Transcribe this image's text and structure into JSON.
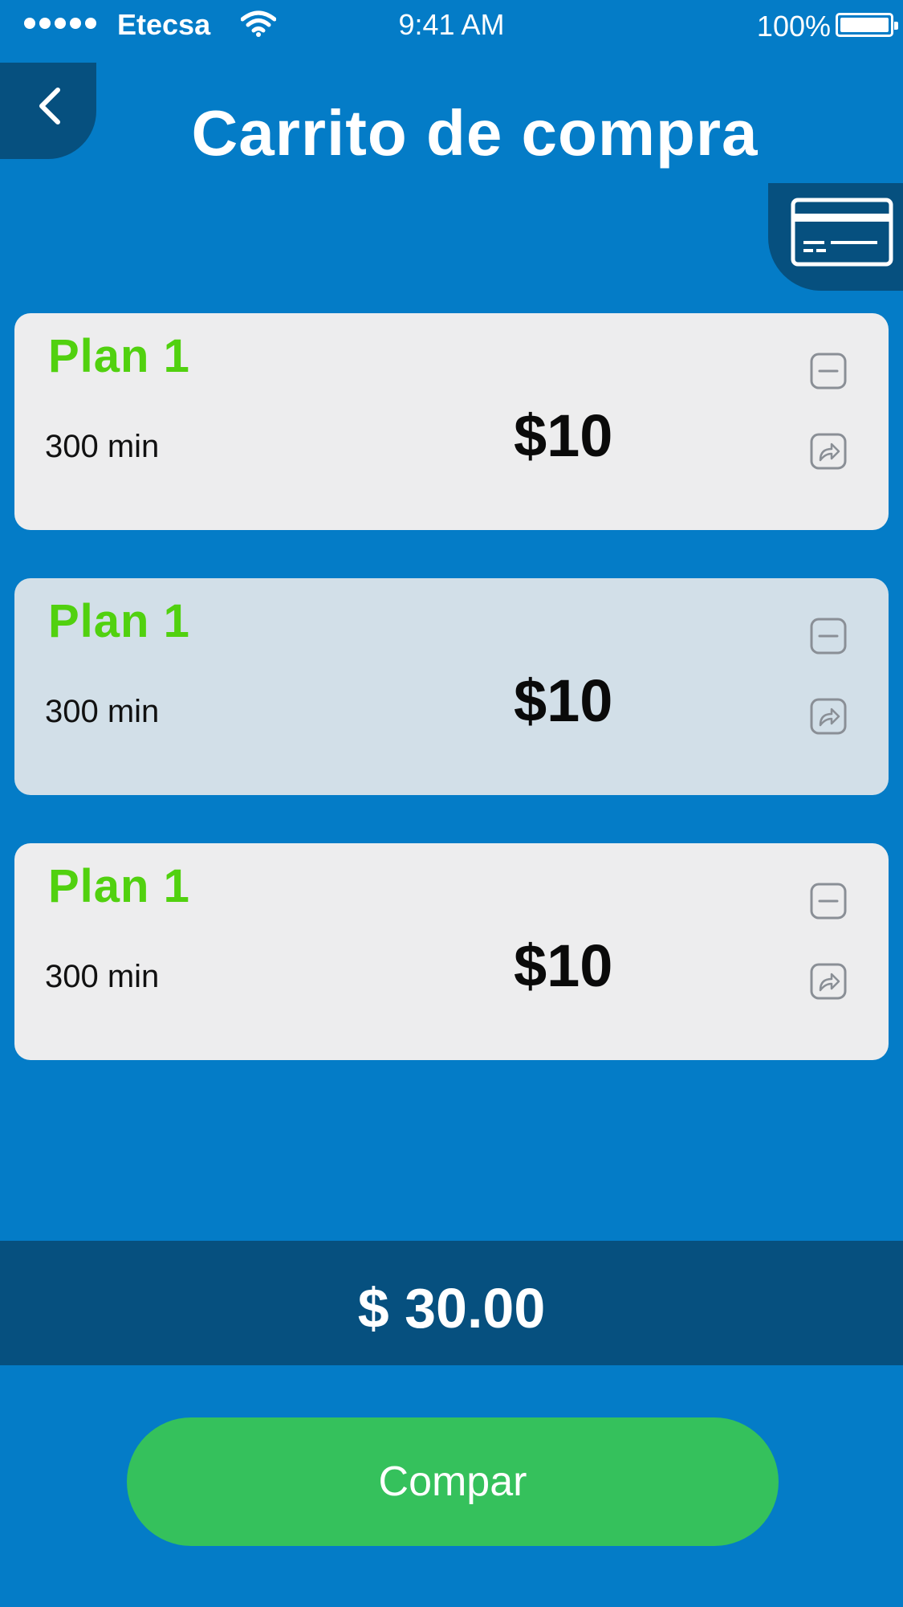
{
  "status_bar": {
    "carrier": "Etecsa",
    "time": "9:41 AM",
    "battery": "100%",
    "signal_bars": 5
  },
  "header": {
    "title": "Carrito de compra",
    "back_icon": "chevron-left-icon",
    "card_icon": "credit-card-icon"
  },
  "cart": {
    "items": [
      {
        "name": "Plan 1",
        "minutes": "300 min",
        "price": "$10",
        "selected": false
      },
      {
        "name": "Plan 1",
        "minutes": "300 min",
        "price": "$10",
        "selected": true
      },
      {
        "name": "Plan 1",
        "minutes": "300 min",
        "price": "$10",
        "selected": false
      }
    ],
    "item_icons": [
      "minus-square-icon",
      "share-arrow-icon"
    ]
  },
  "total": {
    "amount": "$ 30.00"
  },
  "buy_button": {
    "label": "Compar"
  },
  "colors": {
    "background": "#047cc7",
    "dark_blue": "#06507f",
    "plan_name_green": "#51d10f",
    "button_green": "#35c15c",
    "card_bg": "#ededee",
    "card_selected_bg": "#d2dfe8"
  }
}
